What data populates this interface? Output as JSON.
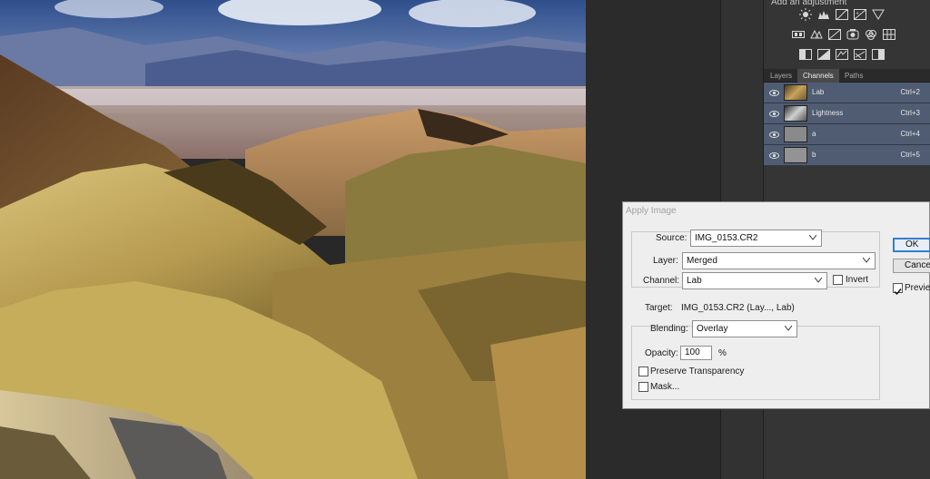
{
  "adjustments": {
    "title": "Add an adjustment",
    "row1_icons": [
      "brightness-contrast-icon",
      "levels-icon",
      "curves-icon",
      "exposure-icon",
      "gradient-triangle-icon"
    ],
    "row2_icons": [
      "color-balance-icon",
      "black-white-icon",
      "photo-filter-icon",
      "channel-mixer-icon",
      "color-lookup-icon",
      "grid-icon"
    ],
    "row3_icons": [
      "invert-icon",
      "posterize-icon",
      "threshold-icon",
      "gradient-map-icon",
      "selective-color-icon"
    ]
  },
  "tabs": [
    "Layers",
    "Channels",
    "Paths"
  ],
  "channels": [
    {
      "name": "Lab",
      "shortcut": "Ctrl+2"
    },
    {
      "name": "Lightness",
      "shortcut": "Ctrl+3"
    },
    {
      "name": "a",
      "shortcut": "Ctrl+4"
    },
    {
      "name": "b",
      "shortcut": "Ctrl+5"
    }
  ],
  "dialog": {
    "title": "Apply Image",
    "source_label": "Source:",
    "source_value": "IMG_0153.CR2",
    "layer_label": "Layer:",
    "layer_value": "Merged",
    "channel_label": "Channel:",
    "channel_value": "Lab",
    "invert_label": "Invert",
    "invert_checked": false,
    "target_label": "Target:",
    "target_value": "IMG_0153.CR2 (Lay..., Lab)",
    "blending_label": "Blending:",
    "blending_value": "Overlay",
    "opacity_label": "Opacity:",
    "opacity_value": "100",
    "opacity_unit": "%",
    "preserve_label": "Preserve Transparency",
    "preserve_checked": false,
    "mask_label": "Mask...",
    "mask_checked": false,
    "ok_label": "OK",
    "cancel_label": "Cance",
    "preview_label": "Previe",
    "preview_checked": true
  },
  "colors": {
    "selection_row": "#4f5c72",
    "default_button_border": "#2f7fd1",
    "panel": "#353535"
  }
}
